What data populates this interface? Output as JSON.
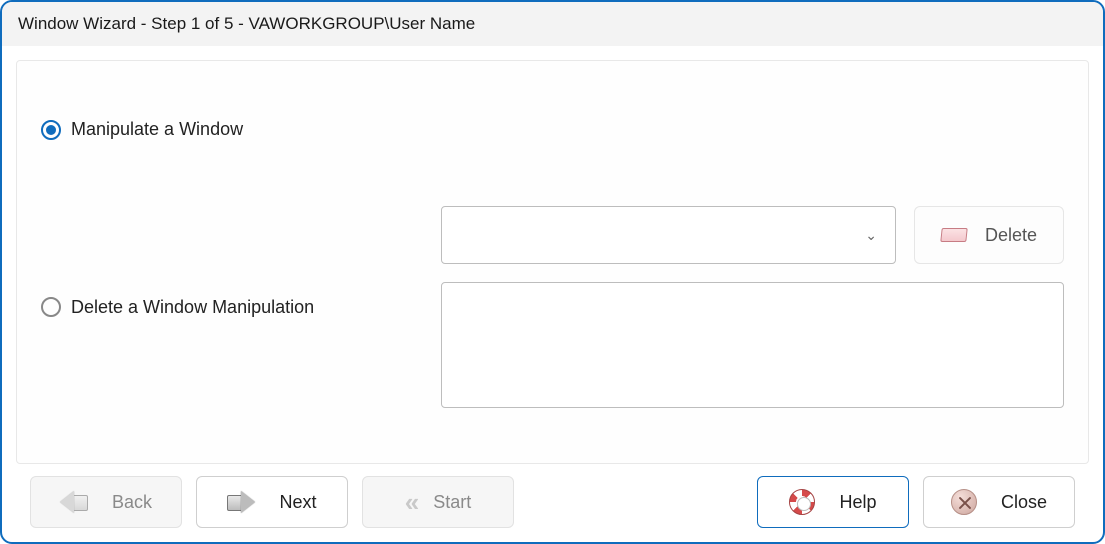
{
  "window": {
    "title": "Window Wizard - Step 1 of 5 - VAWORKGROUP\\User Name"
  },
  "options": {
    "manipulate": {
      "label": "Manipulate a Window",
      "selected": true
    },
    "delete": {
      "label": "Delete a Window Manipulation",
      "selected": false
    }
  },
  "controls": {
    "combo_value": "",
    "delete_button": "Delete"
  },
  "footer": {
    "back": "Back",
    "next": "Next",
    "start": "Start",
    "help": "Help",
    "close": "Close"
  }
}
